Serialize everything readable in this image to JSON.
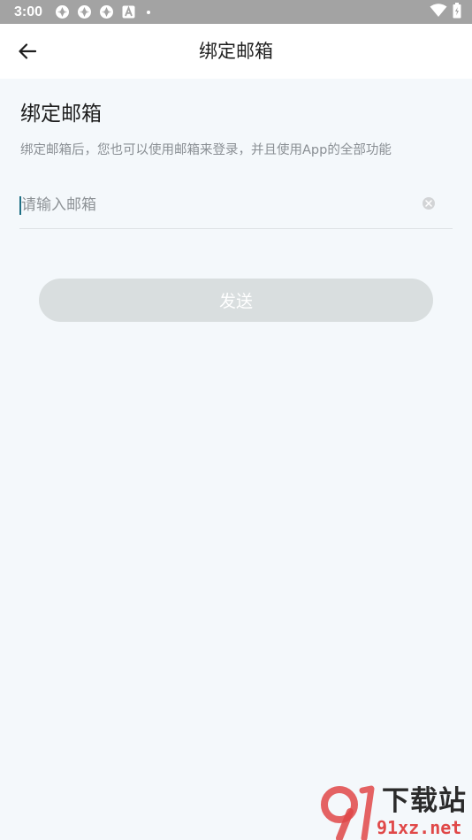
{
  "status_bar": {
    "time": "3:00",
    "left_icons": [
      "aperture-icon",
      "aperture-icon",
      "aperture-icon",
      "app-a-icon"
    ],
    "right_icons": [
      "wifi-icon",
      "battery-icon"
    ]
  },
  "app_bar": {
    "title": "绑定邮箱",
    "back_icon": "arrow-left-icon"
  },
  "content": {
    "heading": "绑定邮箱",
    "description": "绑定邮箱后，您也可以使用邮箱来登录，并且使用App的全部功能",
    "email_input": {
      "value": "",
      "placeholder": "请输入邮箱"
    },
    "clear_icon": "clear-circle-icon",
    "send_label": "发送"
  },
  "watermark": {
    "name": "下载站",
    "domain": "91xz.net"
  },
  "colors": {
    "background": "#f4f8fb",
    "status_bar": "#a3a3a3",
    "button_disabled": "#d9dedf",
    "cursor": "#1f6f84",
    "watermark_red": "#e04848"
  }
}
